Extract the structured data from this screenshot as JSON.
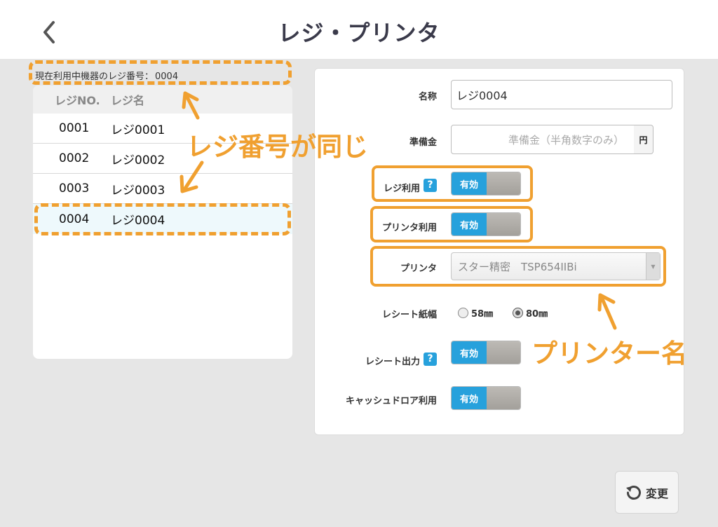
{
  "header": {
    "title": "レジ・プリンタ"
  },
  "current": {
    "label": "現在利用中機器のレジ番号：",
    "value": "0004"
  },
  "list": {
    "columns": [
      "レジNO.",
      "レジ名"
    ],
    "rows": [
      {
        "no": "0001",
        "name": "レジ0001"
      },
      {
        "no": "0002",
        "name": "レジ0002"
      },
      {
        "no": "0003",
        "name": "レジ0003"
      },
      {
        "no": "0004",
        "name": "レジ0004"
      }
    ]
  },
  "form": {
    "name_label": "名称",
    "name_value": "レジ0004",
    "deposit_label": "準備金",
    "deposit_placeholder": "準備金（半角数字のみ）",
    "deposit_unit": "円",
    "register_use_label": "レジ利用",
    "printer_use_label": "プリンタ利用",
    "printer_label": "プリンタ",
    "printer_value": "スター精密　TSP654IIBi",
    "receipt_width_label": "レシート紙幅",
    "width_options": [
      "58㎜",
      "80㎜"
    ],
    "width_selected": "80㎜",
    "receipt_output_label": "レシート出力",
    "cash_drawer_label": "キャッシュドロア利用",
    "toggle_on_label": "有効",
    "help_mark": "?"
  },
  "change_button": {
    "label": "変更"
  },
  "annotations": {
    "same_number": "レジ番号が同じ",
    "printer_name": "プリンター名",
    "color": "#f0a030"
  },
  "colors": {
    "accent": "#27a1dc",
    "selected_row": "#eef9fc",
    "background": "#e6e6e6"
  }
}
